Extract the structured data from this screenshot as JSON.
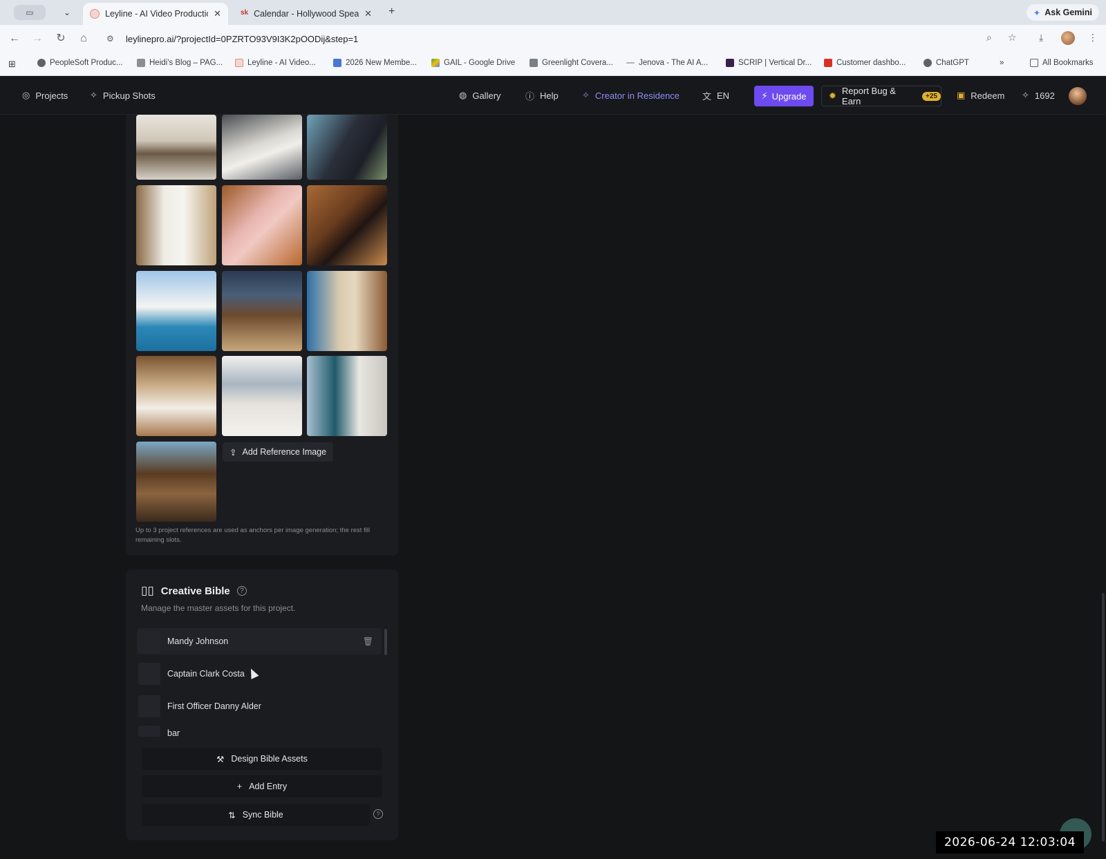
{
  "browser": {
    "tabs": [
      {
        "title": "Leyline - AI Video Production",
        "active": true
      },
      {
        "title": "Calendar - Hollywood Speakers",
        "active": false
      }
    ],
    "ask_gemini": "Ask Gemini",
    "url": "leylinepro.ai/?projectId=0PZRTO93V9I3K2pOODij&step=1",
    "bookmarks": [
      "PeopleSoft Produc...",
      "Heidi's Blog – PAG...",
      "Leyline - AI Video...",
      "2026 New Membe...",
      "GAIL - Google Drive",
      "Greenlight Covera...",
      "Jenova - The AI A...",
      "SCRIP | Vertical Dr...",
      "Customer dashbo...",
      "ChatGPT"
    ],
    "more_bookmarks": "»",
    "all_bookmarks": "All Bookmarks"
  },
  "header": {
    "projects": "Projects",
    "pickup_shots": "Pickup Shots",
    "gallery": "Gallery",
    "help": "Help",
    "creator_in_residence": "Creator in Residence",
    "language": "EN",
    "upgrade": "Upgrade",
    "report_bug": "Report Bug & Earn",
    "report_badge": "+25",
    "redeem": "Redeem",
    "credits": "1692"
  },
  "references": {
    "add_button": "Add Reference Image",
    "note": "Up to 3 project references are used as anchors per image generation; the rest fill remaining slots."
  },
  "creative_bible": {
    "title": "Creative Bible",
    "subtitle": "Manage the master assets for this project.",
    "entries": [
      "Mandy Johnson",
      "Captain Clark Costa",
      "First Officer Danny Alder",
      "bar"
    ],
    "design_button": "Design Bible Assets",
    "add_entry": "Add Entry",
    "sync": "Sync Bible"
  },
  "overlay": {
    "timestamp": "2026-06-24 12:03:04"
  },
  "colors": {
    "accent": "#6d4bf0",
    "creator_text": "#8f8cf5",
    "badge": "#e0b02f",
    "background": "#141517",
    "panel": "#1b1c20"
  }
}
